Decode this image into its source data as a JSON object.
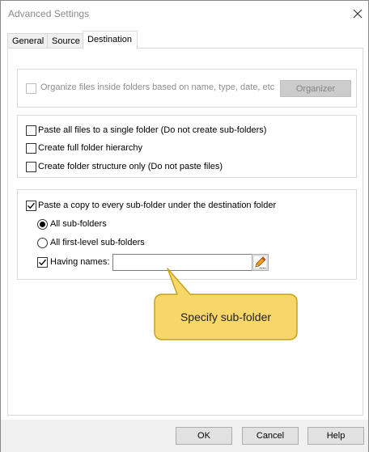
{
  "window": {
    "title": "Advanced Settings"
  },
  "tabs": [
    {
      "label": "General",
      "active": false
    },
    {
      "label": "Source",
      "active": false
    },
    {
      "label": "Destination",
      "active": true
    }
  ],
  "organize": {
    "label": "Organize files inside folders based on name, type, date, etc",
    "checked": false,
    "enabled": false,
    "button_label": "Organizer"
  },
  "structure_options": [
    {
      "label": "Paste all files to a single folder (Do not create sub-folders)",
      "checked": false
    },
    {
      "label": "Create full folder hierarchy",
      "checked": false
    },
    {
      "label": "Create folder structure only (Do not paste files)",
      "checked": false
    }
  ],
  "subfolder": {
    "checkbox_label": "Paste a copy to every sub-folder under the destination folder",
    "checked": true,
    "radios": [
      {
        "label": "All sub-folders",
        "selected": true
      },
      {
        "label": "All first-level sub-folders",
        "selected": false
      }
    ],
    "having_names": {
      "label": "Having names:",
      "checked": true,
      "value": "",
      "picker_icon": "pencil-icon"
    }
  },
  "callout": {
    "text": "Specify sub-folder",
    "fill": "#f8d76a",
    "stroke": "#c8a21a"
  },
  "footer": {
    "ok_label": "OK",
    "cancel_label": "Cancel",
    "help_label": "Help"
  }
}
